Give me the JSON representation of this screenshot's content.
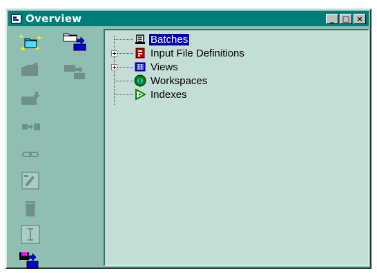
{
  "window": {
    "title": "Overview",
    "controls": {
      "minimize": "_",
      "maximize": "□",
      "close": "×"
    }
  },
  "toolbar": {
    "tools": [
      {
        "name": "new-batch-tool",
        "icon": "new-folder-sparkle-icon",
        "enabled": true
      },
      {
        "name": "open-batch-tool",
        "icon": "folder-export-icon",
        "enabled": true
      },
      {
        "name": "move-left-tool",
        "icon": "folder-back-icon",
        "enabled": false
      },
      {
        "name": "move-right-tool",
        "icon": "folder-forward-icon",
        "enabled": false
      },
      {
        "name": "download-tool",
        "icon": "folder-down-icon",
        "enabled": false
      },
      {
        "name": "transfer-tool",
        "icon": "transfer-icon",
        "enabled": false
      },
      {
        "name": "link-tool",
        "icon": "chain-link-icon",
        "enabled": false
      },
      {
        "name": "edit-tool",
        "icon": "edit-form-icon",
        "enabled": false
      },
      {
        "name": "delete-tool",
        "icon": "trash-icon",
        "enabled": false
      },
      {
        "name": "text-tool",
        "icon": "text-cursor-icon",
        "enabled": false
      },
      {
        "name": "export-tool",
        "icon": "disk-export-icon",
        "enabled": true
      }
    ]
  },
  "tree": {
    "items": [
      {
        "label": "Batches",
        "icon": "scroll-icon",
        "expandable": false,
        "selected": true
      },
      {
        "label": "Input File Definitions",
        "icon": "file-def-icon",
        "expandable": true,
        "selected": false
      },
      {
        "label": "Views",
        "icon": "table-view-icon",
        "expandable": true,
        "selected": false
      },
      {
        "label": "Workspaces",
        "icon": "globe-icon",
        "expandable": false,
        "selected": false
      },
      {
        "label": "Indexes",
        "icon": "play-index-icon",
        "expandable": false,
        "selected": false
      }
    ]
  },
  "colors": {
    "title_bar": "#007e7a",
    "window_bg": "#8fbfb3",
    "tree_bg": "#c4ddd6",
    "selection": "#0000a8"
  }
}
